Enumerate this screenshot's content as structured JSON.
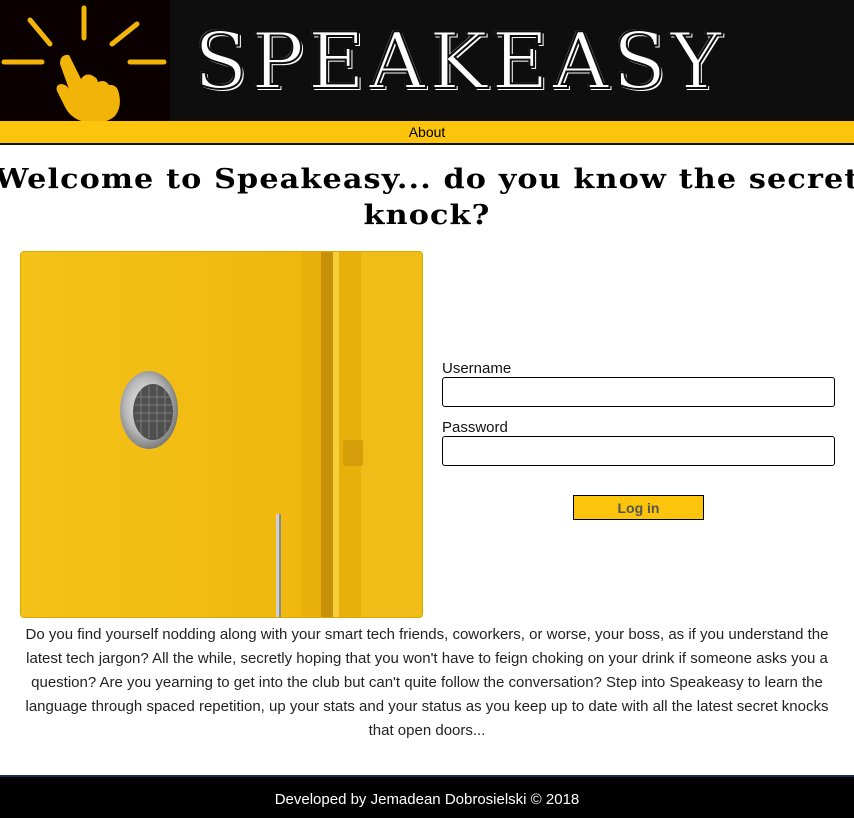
{
  "header": {
    "brand": "SPEAKEASY",
    "logo_icon": "knocking-hand-icon"
  },
  "nav": {
    "items": [
      {
        "label": "About"
      }
    ]
  },
  "hero": {
    "headline": "Welcome to Speakeasy... do you know the secret knock?"
  },
  "login": {
    "username_label": "Username",
    "username_value": "",
    "password_label": "Password",
    "password_value": "",
    "submit_label": "Log in"
  },
  "intro": {
    "paragraph": "Do you find yourself nodding along with your smart tech friends, coworkers, or worse, your boss, as if you understand the latest tech jargon? All the while, secretly hoping that you won't have to feign choking on your drink if someone asks you a question? Are you yearning to get into the club but can't quite follow the conversation? Step into Speakeasy to learn the language through spaced repetition, up your stats and your status as you keep up to date with all the latest secret knocks that open doors..."
  },
  "footer": {
    "credit": "Developed by Jemadean Dobrosielski © 2018"
  },
  "colors": {
    "accent": "#fcc40a",
    "header_bg": "#0e0e0e",
    "footer_bg": "#000000",
    "door_yellow": "#f2bb12"
  }
}
